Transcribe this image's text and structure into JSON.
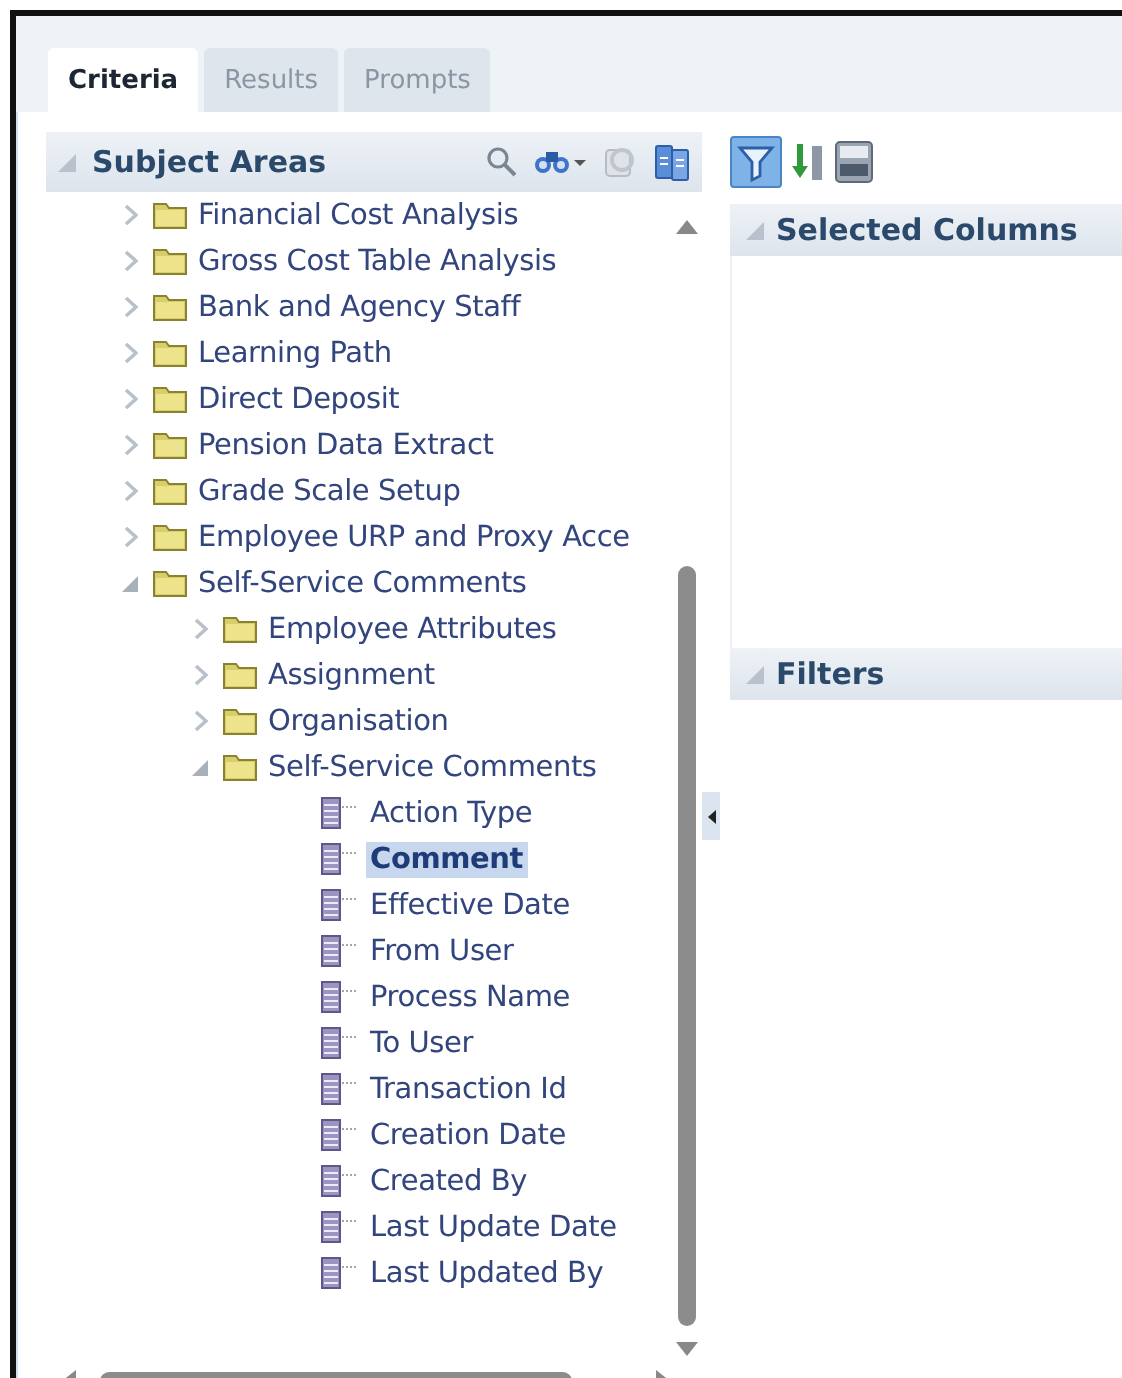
{
  "tabs": [
    {
      "label": "Criteria",
      "selected": true
    },
    {
      "label": "Results",
      "selected": false
    },
    {
      "label": "Prompts",
      "selected": false
    }
  ],
  "subject_areas": {
    "title": "Subject Areas",
    "tree": [
      {
        "label": "Financial Cost Analysis",
        "kind": "folder",
        "expanded": false
      },
      {
        "label": "Gross Cost Table Analysis",
        "kind": "folder",
        "expanded": false
      },
      {
        "label": "Bank and Agency Staff",
        "kind": "folder",
        "expanded": false
      },
      {
        "label": "Learning Path",
        "kind": "folder",
        "expanded": false
      },
      {
        "label": "Direct Deposit",
        "kind": "folder",
        "expanded": false
      },
      {
        "label": "Pension Data Extract",
        "kind": "folder",
        "expanded": false
      },
      {
        "label": "Grade Scale Setup",
        "kind": "folder",
        "expanded": false
      },
      {
        "label": "Employee URP and Proxy Acce",
        "kind": "folder",
        "expanded": false
      },
      {
        "label": "Self-Service Comments",
        "kind": "folder",
        "expanded": true,
        "children": [
          {
            "label": "Employee Attributes",
            "kind": "folder",
            "expanded": false
          },
          {
            "label": "Assignment",
            "kind": "folder",
            "expanded": false
          },
          {
            "label": "Organisation",
            "kind": "folder",
            "expanded": false
          },
          {
            "label": "Self-Service Comments",
            "kind": "folder",
            "expanded": true,
            "children": [
              {
                "label": "Action Type",
                "kind": "column",
                "selected": false
              },
              {
                "label": "Comment",
                "kind": "column",
                "selected": true
              },
              {
                "label": "Effective Date",
                "kind": "column",
                "selected": false
              },
              {
                "label": "From User",
                "kind": "column",
                "selected": false
              },
              {
                "label": "Process Name",
                "kind": "column",
                "selected": false
              },
              {
                "label": "To User",
                "kind": "column",
                "selected": false
              },
              {
                "label": "Transaction Id",
                "kind": "column",
                "selected": false
              },
              {
                "label": "Creation Date",
                "kind": "column",
                "selected": false
              },
              {
                "label": "Created By",
                "kind": "column",
                "selected": false
              },
              {
                "label": "Last Update Date",
                "kind": "column",
                "selected": false
              },
              {
                "label": "Last Updated By",
                "kind": "column",
                "selected": false
              }
            ]
          }
        ]
      }
    ]
  },
  "selected_columns": {
    "title": "Selected Columns"
  },
  "filters": {
    "title": "Filters"
  }
}
